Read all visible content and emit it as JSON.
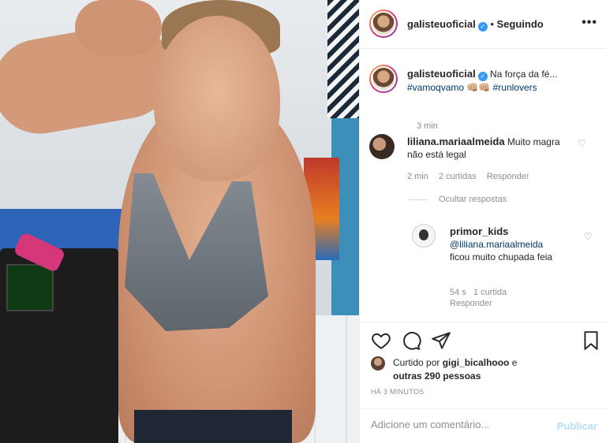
{
  "header": {
    "username": "galisteuoficial",
    "verified_mark": "✓",
    "separator": "•",
    "follow_status": "Seguindo",
    "more": "•••"
  },
  "caption": {
    "username": "galisteuoficial",
    "text_start": "Na força da fé...",
    "hashtags": [
      "#vamoqvamo",
      "#runlovers"
    ],
    "emoji": "👊🏼👊🏼",
    "time": "3 min"
  },
  "comments": [
    {
      "username": "liliana.mariaalmeida",
      "text": "Muito magra não está legal",
      "time": "2 min",
      "likes": "2 curtidas",
      "reply": "Responder"
    }
  ],
  "hide_replies": "Ocultar respostas",
  "reply": {
    "username": "primor_kids",
    "mention": "@liliana.mariaalmeida",
    "text": "ficou muito chupada feia",
    "time": "54 s",
    "likes": "1 curtida",
    "reply": "Responder"
  },
  "likes": {
    "prefix": "Curtido por",
    "user": "gigi_bicalhooo",
    "conj": "e",
    "others": "outras 290 pessoas"
  },
  "timestamp": "HÁ 3 MINUTOS",
  "add_comment": {
    "placeholder": "Adicione um comentário...",
    "publish": "Publicar"
  },
  "colors": {
    "link": "#00376b",
    "verified": "#3897f0",
    "publish_disabled": "#b2dffc",
    "muted": "#8e8e8e"
  },
  "icons": [
    "heart-icon",
    "comment-icon",
    "share-icon",
    "bookmark-icon",
    "more-icon",
    "verified-icon"
  ]
}
